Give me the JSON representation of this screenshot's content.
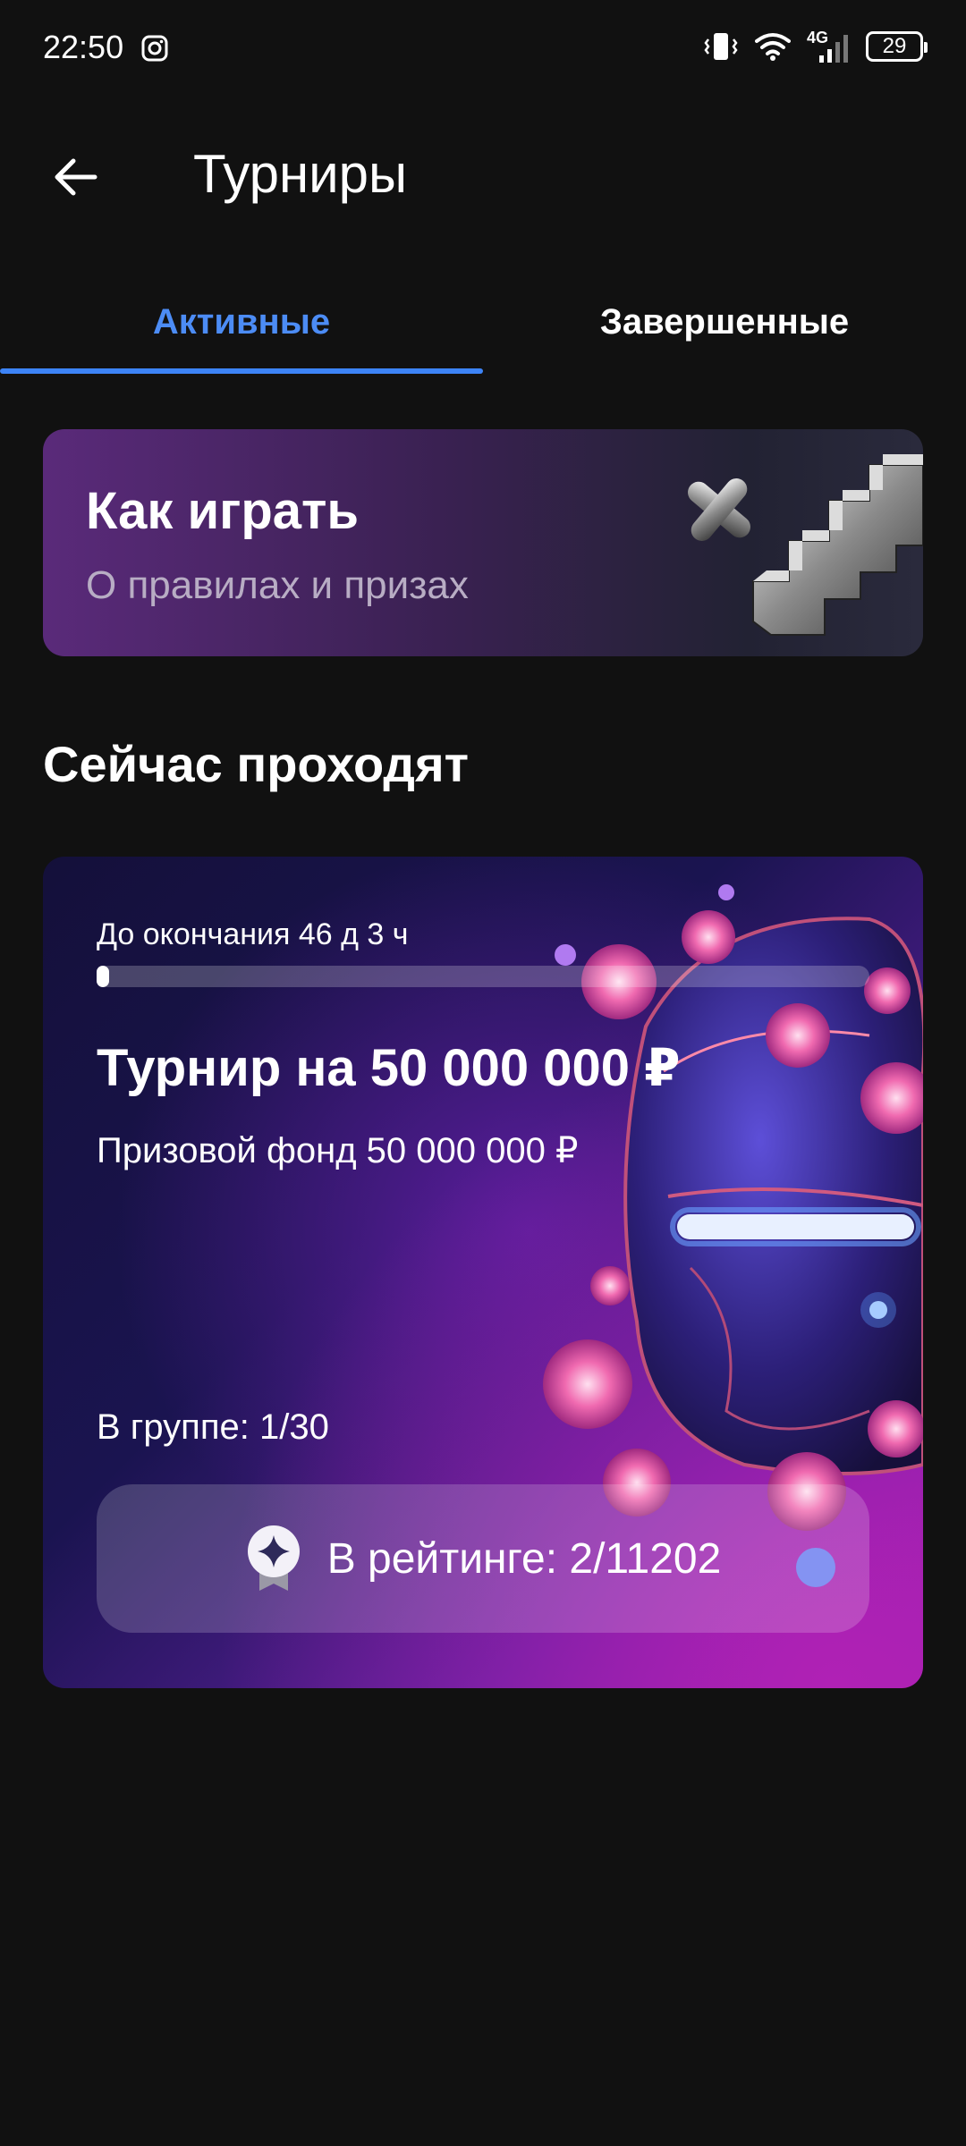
{
  "status_bar": {
    "time": "22:50",
    "network": "4G",
    "battery": "29"
  },
  "header": {
    "title": "Турниры",
    "back_icon": "arrow-left-icon"
  },
  "tabs": [
    {
      "label": "Активные",
      "active": true
    },
    {
      "label": "Завершенные",
      "active": false
    }
  ],
  "how_to_play": {
    "title": "Как играть",
    "subtitle": "О правилах и призах"
  },
  "section_title": "Сейчас проходят",
  "tournament": {
    "deadline": "До окончания 46 д 3 ч",
    "progress_fraction": 0.015,
    "title": "Турнир на 50 000 000 ₽",
    "prize_fund": "Призовой фонд 50 000 000 ₽",
    "group": "В группе: 1/30",
    "rating": "В рейтинге: 2/11202",
    "rating_icon": "rating-badge-icon"
  },
  "colors": {
    "background": "#111111",
    "accent": "#3d84f7",
    "tab_active": "#4c8cf5"
  }
}
